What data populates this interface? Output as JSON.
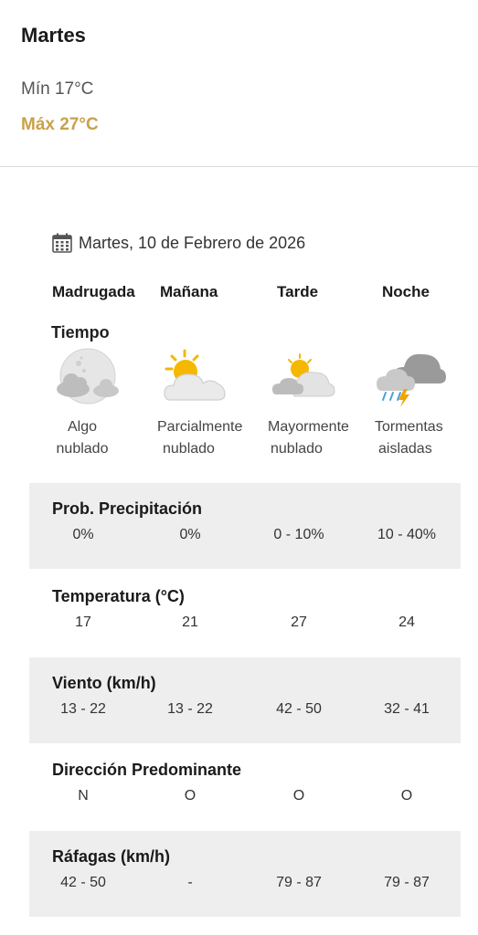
{
  "header": {
    "day": "Martes",
    "min_label": "Mín 17°C",
    "max_label": "Máx 27°C"
  },
  "detail": {
    "date": "Martes, 10 de Febrero de 2026",
    "periods": [
      "Madrugada",
      "Mañana",
      "Tarde",
      "Noche"
    ],
    "tiempo_label": "Tiempo",
    "conditions": [
      {
        "line1": "Algo",
        "line2": "nublado",
        "icon": "moon-partly-cloudy-icon"
      },
      {
        "line1": "Parcialmente",
        "line2": "nublado",
        "icon": "sun-partly-cloudy-icon"
      },
      {
        "line1": "Mayormente",
        "line2": "nublado",
        "icon": "mostly-cloudy-icon"
      },
      {
        "line1": "Tormentas",
        "line2": "aisladas",
        "icon": "thunderstorm-icon"
      }
    ]
  },
  "sections": [
    {
      "title": "Prob. Precipitación",
      "values": [
        "0%",
        "0%",
        "0 - 10%",
        "10 - 40%"
      ]
    },
    {
      "title": "Temperatura (°C)",
      "values": [
        "17",
        "21",
        "27",
        "24"
      ]
    },
    {
      "title": "Viento (km/h)",
      "values": [
        "13 - 22",
        "13 - 22",
        "42 - 50",
        "32 - 41"
      ]
    },
    {
      "title": "Dirección Predominante",
      "values": [
        "N",
        "O",
        "O",
        "O"
      ]
    },
    {
      "title": "Ráfagas (km/h)",
      "values": [
        "42 - 50",
        "-",
        "79 - 87",
        "79 - 87"
      ]
    }
  ],
  "colors": {
    "max_temp": "#c9a14a",
    "shaded_row": "#eeeeee",
    "divider": "#dcdcdc"
  }
}
